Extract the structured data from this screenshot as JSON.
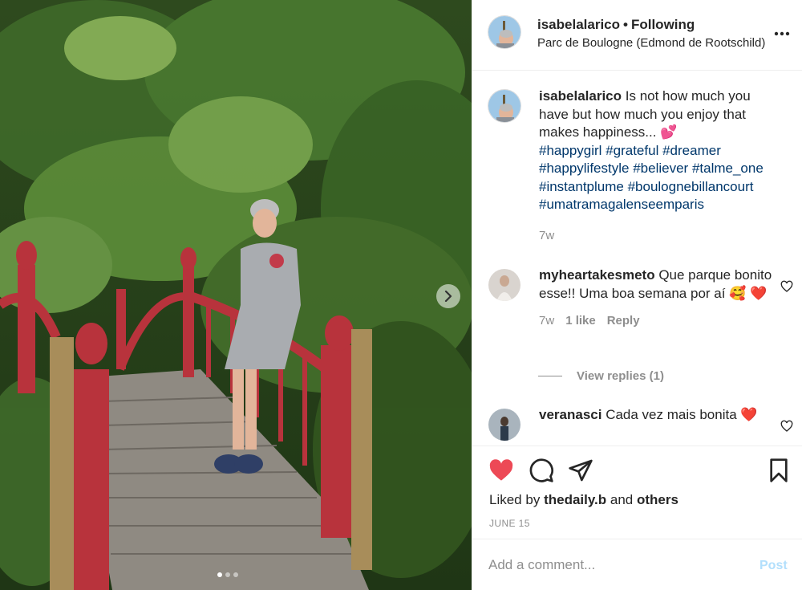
{
  "post": {
    "username": "isabelalarico",
    "separator": "•",
    "follow_state": "Following",
    "location": "Parc de Boulogne (Edmond de Rootschild)"
  },
  "caption": {
    "username": "isabelalarico",
    "text": "Is not how much you have but how much you enjoy that makes happiness... 💕",
    "hashtags": [
      "#happygirl",
      "#grateful",
      "#dreamer",
      "#happylifestyle",
      "#believer",
      "#talme_one",
      "#instantplume",
      "#boulognebillancourt",
      "#umatramagalenseemparis"
    ],
    "age": "7w"
  },
  "comments": [
    {
      "username": "myheartakesmeto",
      "text": "Que parque bonito esse!! Uma boa semana por aí 🥰 ❤️",
      "age": "7w",
      "likes": "1 like",
      "reply_label": "Reply",
      "view_replies": "View replies (1)"
    },
    {
      "username": "veranasci",
      "text": "Cada vez mais bonita ❤️"
    }
  ],
  "likes": {
    "prefix": "Liked by",
    "user": "thedaily.b",
    "conj": "and",
    "others": "others"
  },
  "date": "JUNE 15",
  "add_comment": {
    "placeholder": "Add a comment...",
    "post_label": "Post"
  },
  "carousel": {
    "current": 1,
    "total": 3
  },
  "colors": {
    "liked_heart": "#ed4956",
    "hashtag": "#00376b",
    "post_disabled": "#b2dffc",
    "bridge": "#b8333c"
  }
}
